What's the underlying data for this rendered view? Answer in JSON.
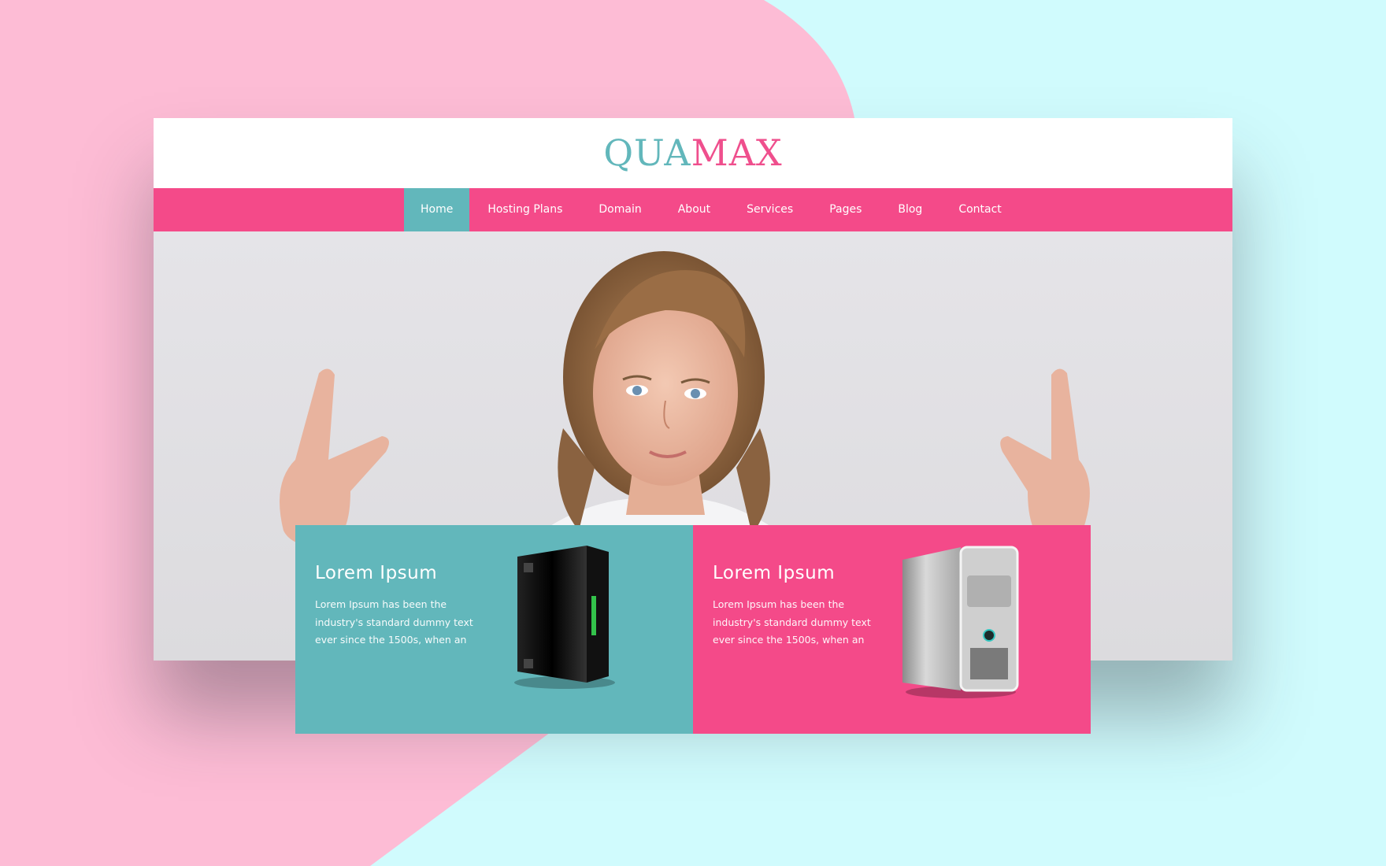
{
  "brand": {
    "logo_part1": "QUA",
    "logo_part2": "MAX"
  },
  "nav": {
    "items": [
      {
        "label": "Home",
        "active": true
      },
      {
        "label": "Hosting Plans"
      },
      {
        "label": "Domain"
      },
      {
        "label": "About"
      },
      {
        "label": "Services"
      },
      {
        "label": "Pages"
      },
      {
        "label": "Blog"
      },
      {
        "label": "Contact"
      }
    ]
  },
  "cards": [
    {
      "title": "Lorem Ipsum",
      "text": "Lorem Ipsum has been the industry's standard dummy text ever since the 1500s, when an",
      "color": "#62b7bb",
      "image": "black-server-tower-image"
    },
    {
      "title": "Lorem Ipsum",
      "text": "Lorem Ipsum has been the industry's standard dummy text ever since the 1500s, when an",
      "color": "#f44a89",
      "image": "silver-pc-tower-image"
    }
  ],
  "colors": {
    "teal": "#62b7bb",
    "pink": "#f44a89",
    "bg_pink": "#fdbcd5",
    "bg_cyan": "#d0fbfd"
  },
  "hero": {
    "image": "woman-pointing-up-photo"
  }
}
